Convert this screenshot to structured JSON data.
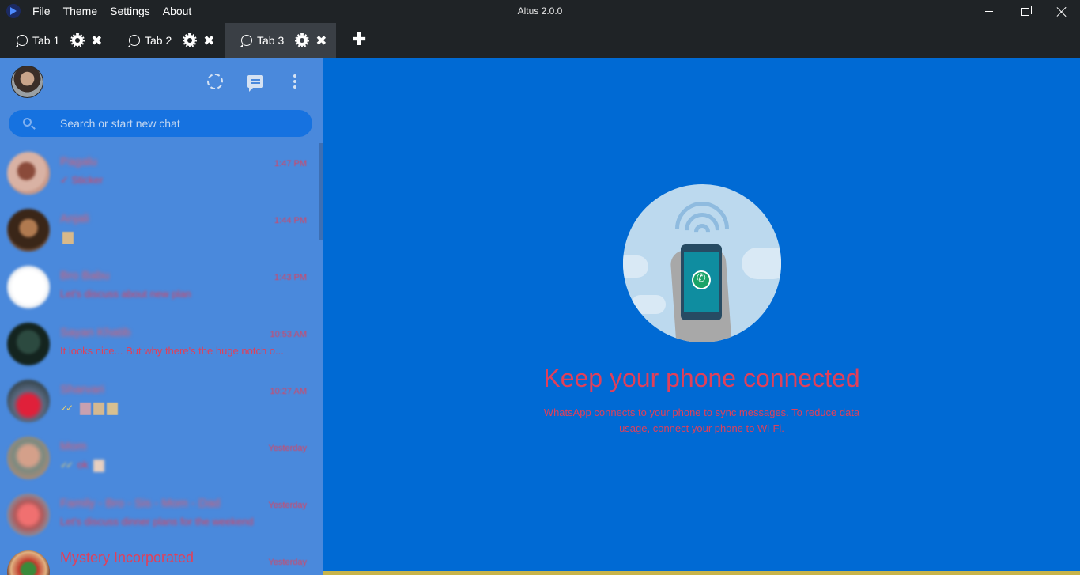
{
  "app": {
    "title": "Altus 2.0.0",
    "menu": [
      "File",
      "Theme",
      "Settings",
      "About"
    ]
  },
  "tabs": [
    {
      "label": "Tab 1",
      "active": false
    },
    {
      "label": "Tab 2",
      "active": false
    },
    {
      "label": "Tab 3",
      "active": true
    }
  ],
  "add_tab_label": "✚",
  "sidebar": {
    "search_placeholder": "Search or start new chat",
    "chats": [
      {
        "name": "Pagalu",
        "time": "1:47 PM",
        "snippet": "✓ Sticker",
        "ticks": "",
        "avatar": "#b88a7a"
      },
      {
        "name": "Anjali",
        "time": "1:44 PM",
        "snippet": "",
        "ticks": "",
        "avatar": "#4a3424"
      },
      {
        "name": "Bro Babu",
        "time": "1:43 PM",
        "snippet": "Let's discuss about new plan",
        "ticks": "",
        "avatar": "#f3f3f3"
      },
      {
        "name": "Sayan Khatib",
        "time": "10:53 AM",
        "snippet": "It looks nice... But why there's the huge notch o...",
        "ticks": "",
        "avatar": "#1e3a33"
      },
      {
        "name": "Sharvari",
        "time": "10:27 AM",
        "snippet": "",
        "ticks": "✓✓",
        "avatar": "#a04048"
      },
      {
        "name": "Mom",
        "time": "Yesterday",
        "snippet": "ok",
        "ticks": "✓✓",
        "avatar": "#a08070"
      },
      {
        "name": "Family - Bro - Sis - Mom - Dad",
        "time": "Yesterday",
        "snippet": "Let's discuss dinner plans for the weekend",
        "ticks": "",
        "avatar": "#d07070"
      },
      {
        "name": "Mystery Incorporated",
        "time": "Yesterday",
        "snippet": "",
        "ticks": "",
        "avatar": "#8a4a3a"
      }
    ]
  },
  "main": {
    "title": "Keep your phone connected",
    "description": "WhatsApp connects to your phone to sync messages. To reduce data usage, connect your phone to Wi-Fi."
  },
  "colors": {
    "sidebar": "#4a89dc",
    "main": "#006ad4",
    "accent_text": "#e0405a",
    "titlebar": "#1f2326"
  }
}
